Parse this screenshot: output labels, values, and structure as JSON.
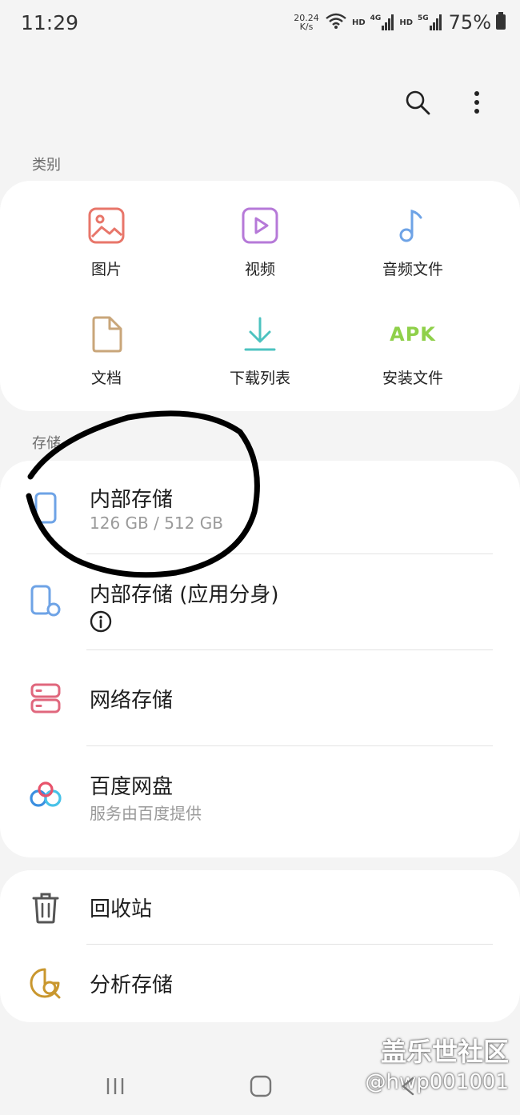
{
  "status_bar": {
    "time": "11:29",
    "net_speed_value": "20.24",
    "net_speed_unit": "K/s",
    "hd1": "HD",
    "sig1": "4G",
    "hd2": "HD",
    "sig2": "5G",
    "battery": "75%"
  },
  "categories": {
    "header": "类别",
    "items": [
      {
        "label": "图片",
        "icon": "image-icon",
        "color": "#e8766a"
      },
      {
        "label": "视频",
        "icon": "video-icon",
        "color": "#b679d8"
      },
      {
        "label": "音频文件",
        "icon": "music-icon",
        "color": "#6ea3e6"
      },
      {
        "label": "文档",
        "icon": "document-icon",
        "color": "#c9a67a"
      },
      {
        "label": "下载列表",
        "icon": "download-icon",
        "color": "#4dc3c0"
      },
      {
        "label": "安装文件",
        "icon": "apk-icon",
        "icon_text": "APK",
        "color": "#8fd04a"
      }
    ]
  },
  "storage": {
    "header": "存储",
    "items": [
      {
        "title": "内部存储",
        "subtitle": "126 GB / 512 GB",
        "icon": "phone-icon"
      },
      {
        "title": "内部存储 (应用分身)",
        "icon": "dual-app-phone-icon",
        "info_icon": "info-icon"
      },
      {
        "title": "网络存储",
        "icon": "network-storage-icon"
      },
      {
        "title": "百度网盘",
        "subtitle": "服务由百度提供",
        "icon": "baidu-netdisk-icon"
      }
    ]
  },
  "tools": {
    "items": [
      {
        "title": "回收站",
        "icon": "trash-icon"
      },
      {
        "title": "分析存储",
        "icon": "analyze-storage-icon"
      }
    ]
  },
  "watermark": {
    "line1": "盖乐世社区",
    "line2": "@hwp001001"
  }
}
